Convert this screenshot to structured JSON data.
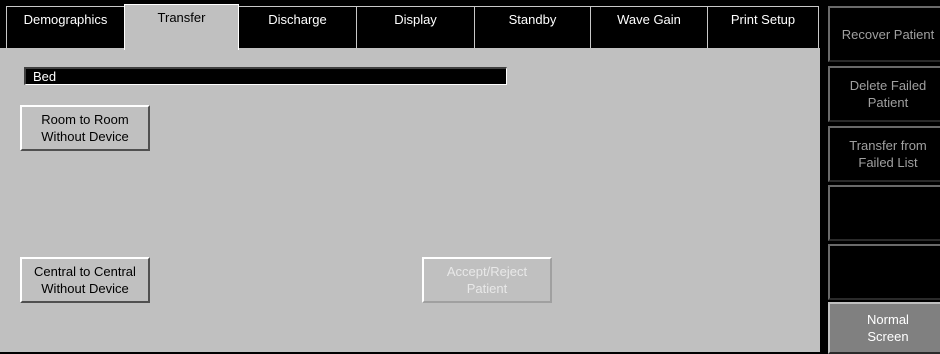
{
  "tabs": [
    {
      "label": "Demographics",
      "active": false
    },
    {
      "label": "Transfer",
      "active": true
    },
    {
      "label": "Discharge",
      "active": false
    },
    {
      "label": "Display",
      "active": false
    },
    {
      "label": "Standby",
      "active": false
    },
    {
      "label": "Wave Gain",
      "active": false
    },
    {
      "label": "Print Setup",
      "active": false
    }
  ],
  "panel": {
    "bed_label": "Bed",
    "room_to_room": "Room to Room\nWithout Device",
    "central_to_central": "Central to Central\nWithout Device",
    "accept_reject": "Accept/Reject\nPatient"
  },
  "sidebar": {
    "buttons": [
      {
        "label": "Recover Patient"
      },
      {
        "label": "Delete Failed\nPatient"
      },
      {
        "label": "Transfer from\nFailed List"
      },
      {
        "label": ""
      },
      {
        "label": ""
      },
      {
        "label": "Normal\nScreen"
      }
    ]
  }
}
